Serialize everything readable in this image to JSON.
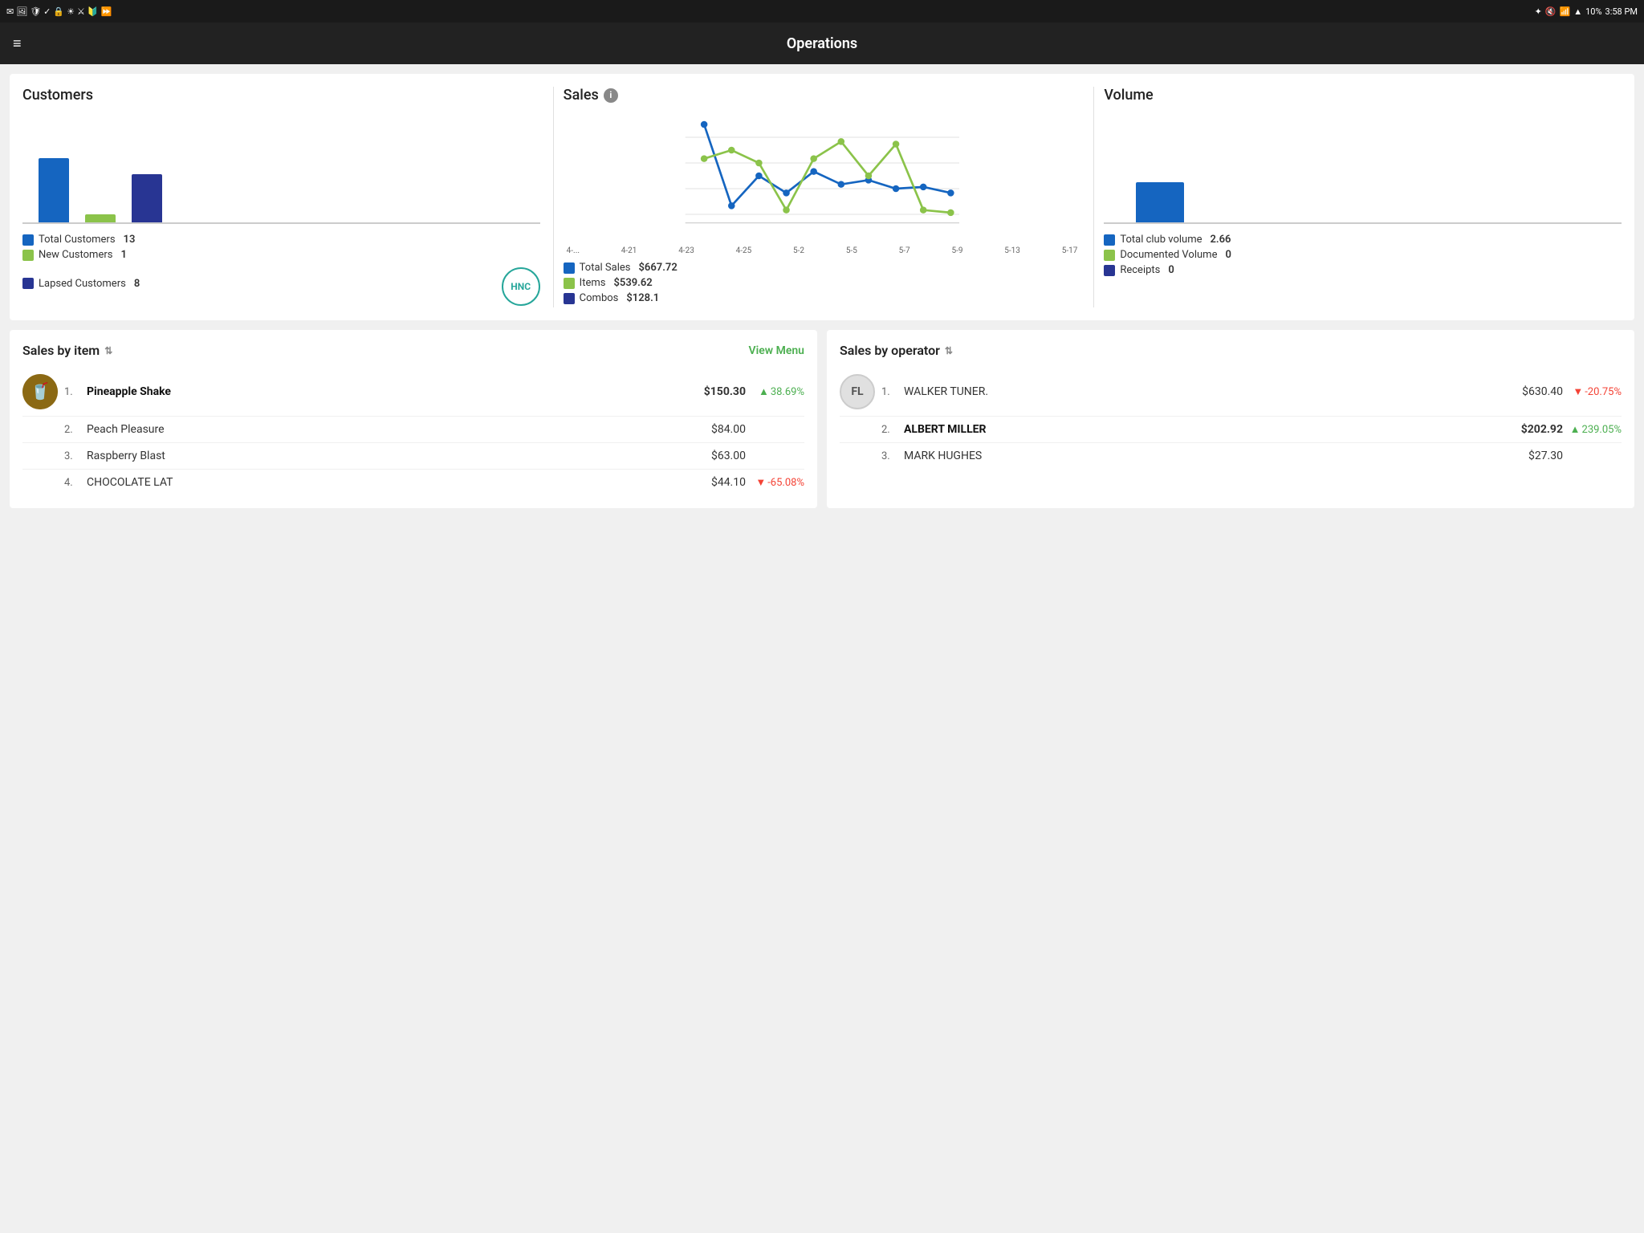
{
  "statusBar": {
    "time": "3:58 PM",
    "battery": "10%"
  },
  "header": {
    "title": "Operations",
    "menuIcon": "≡"
  },
  "customers": {
    "sectionTitle": "Customers",
    "bars": [
      {
        "label": "Total",
        "height": 80,
        "color": "#1565c0"
      },
      {
        "label": "New",
        "height": 10,
        "color": "#8bc34a"
      },
      {
        "label": "Lapsed",
        "height": 60,
        "color": "#283593"
      }
    ],
    "legend": [
      {
        "label": "Total Customers",
        "value": "13",
        "color": "#1565c0"
      },
      {
        "label": "New Customers",
        "value": "1",
        "color": "#8bc34a"
      },
      {
        "label": "Lapsed Customers 8",
        "value": "",
        "color": "#283593"
      }
    ],
    "badge": "HNC"
  },
  "sales": {
    "sectionTitle": "Sales",
    "infoIcon": "i",
    "xLabels": [
      "4-...",
      "4-21",
      "4-23",
      "4-25",
      "5-2",
      "5-5",
      "5-7",
      "5-9",
      "5-13",
      "5-17"
    ],
    "legend": [
      {
        "label": "Total Sales",
        "value": "$667.72",
        "color": "#1565c0"
      },
      {
        "label": "Items",
        "value": "$539.62",
        "color": "#8bc34a"
      },
      {
        "label": "Combos",
        "value": "$128.1",
        "color": "#283593"
      }
    ]
  },
  "volume": {
    "sectionTitle": "Volume",
    "legend": [
      {
        "label": "Total club volume",
        "value": "2.66",
        "color": "#1565c0"
      },
      {
        "label": "Documented Volume",
        "value": "0",
        "color": "#8bc34a"
      },
      {
        "label": "Receipts",
        "value": "0",
        "color": "#283593"
      }
    ]
  },
  "salesByItem": {
    "title": "Sales by item",
    "viewMenuLabel": "View Menu",
    "items": [
      {
        "rank": "1.",
        "name": "Pineapple Shake",
        "price": "$150.30",
        "change": "38.69%",
        "changeDir": "up",
        "bold": true,
        "hasThumb": true
      },
      {
        "rank": "2.",
        "name": "Peach Pleasure",
        "price": "$84.00",
        "change": "",
        "changeDir": "",
        "bold": false,
        "hasThumb": false
      },
      {
        "rank": "3.",
        "name": "Raspberry Blast",
        "price": "$63.00",
        "change": "",
        "changeDir": "",
        "bold": false,
        "hasThumb": false
      },
      {
        "rank": "4.",
        "name": "CHOCOLATE LAT",
        "price": "$44.10",
        "change": "-65.08%",
        "changeDir": "down",
        "bold": false,
        "hasThumb": false
      }
    ]
  },
  "salesByOperator": {
    "title": "Sales by operator",
    "operators": [
      {
        "rank": "1.",
        "name": "WALKER TUNER.",
        "price": "$630.40",
        "change": "-20.75%",
        "changeDir": "down",
        "bold": false,
        "initials": "FL",
        "avatarColor": "#e0e0e0"
      },
      {
        "rank": "2.",
        "name": "ALBERT MILLER",
        "price": "$202.92",
        "change": "239.05%",
        "changeDir": "up",
        "bold": true,
        "initials": "",
        "avatarColor": ""
      },
      {
        "rank": "3.",
        "name": "MARK HUGHES",
        "price": "$27.30",
        "change": "",
        "changeDir": "",
        "bold": false,
        "initials": "",
        "avatarColor": ""
      }
    ]
  }
}
